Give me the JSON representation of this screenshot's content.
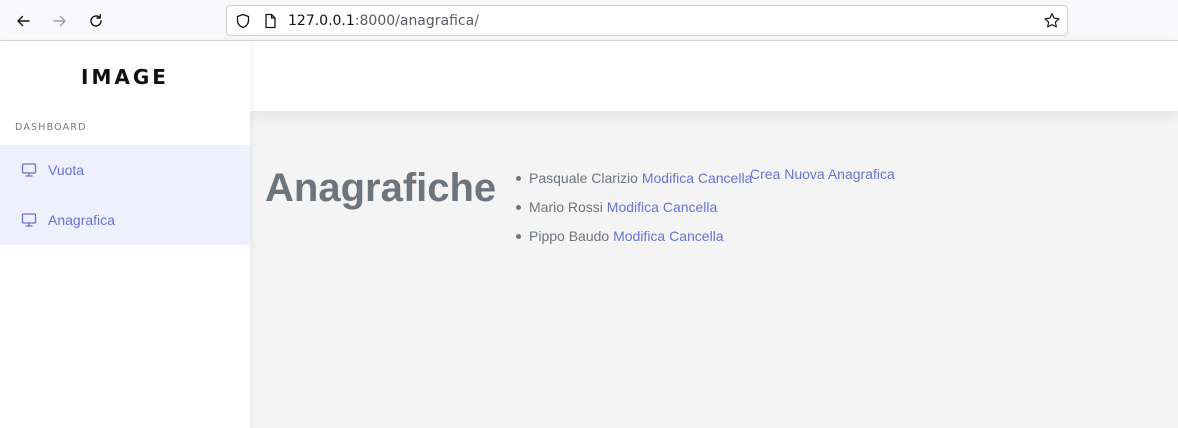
{
  "browser": {
    "url_host": "127.0.0.1",
    "url_rest": ":8000/anagrafica/"
  },
  "sidebar": {
    "brand": "IMAGE",
    "section_label": "DASHBOARD",
    "items": [
      {
        "label": "Vuota",
        "icon": "monitor-icon"
      },
      {
        "label": "Anagrafica",
        "icon": "monitor-icon"
      }
    ]
  },
  "main": {
    "title": "Anagrafiche",
    "create_label": "Crea Nuova Anagrafica",
    "records": [
      {
        "name": "Pasquale Clarizio",
        "edit_label": "Modifica",
        "delete_label": "Cancella"
      },
      {
        "name": "Mario Rossi",
        "edit_label": "Modifica",
        "delete_label": "Cancella"
      },
      {
        "name": "Pippo Baudo",
        "edit_label": "Modifica",
        "delete_label": "Cancella"
      }
    ]
  },
  "colors": {
    "accent": "#6774d2",
    "text_muted": "#6c757d",
    "menu_bg": "#eff0fd",
    "content_bg": "#f4f4f4"
  }
}
